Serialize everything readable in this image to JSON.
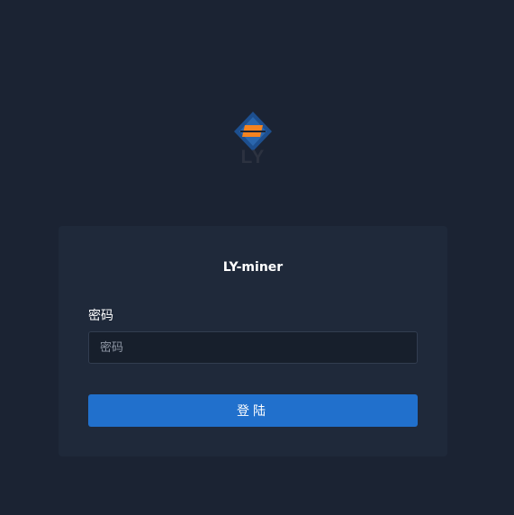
{
  "logo": {
    "text": "LY",
    "icon": "diamond-logo-icon",
    "colors": {
      "diamond": "#1d4f8f",
      "accent": "#f5831f",
      "text": "#2c3240"
    }
  },
  "login": {
    "title": "LY-miner",
    "password_label": "密码",
    "password_placeholder": "密码",
    "submit_label": "登陆"
  },
  "theme": {
    "background": "#1b2333",
    "card": "#1f293a",
    "input_bg": "#171f2c",
    "input_border": "#323d50",
    "button": "#2170cc",
    "text": "#ffffff"
  }
}
